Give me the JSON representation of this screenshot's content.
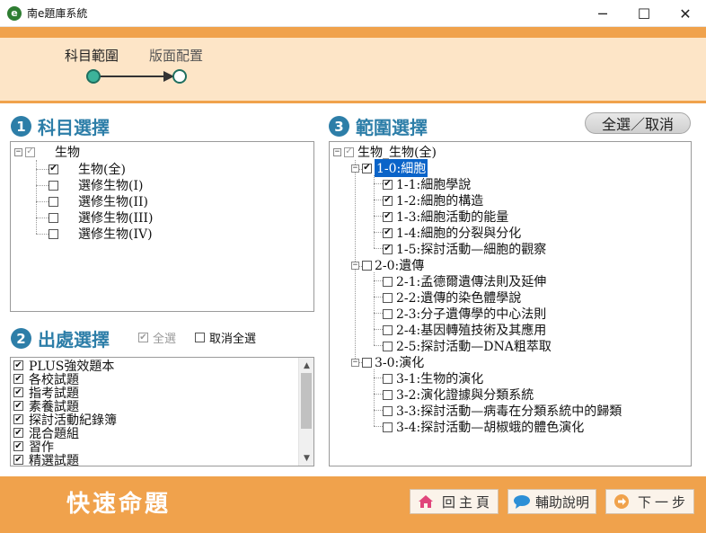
{
  "window": {
    "title": "南e題庫系統",
    "app_icon_glyph": "e",
    "controls": {
      "minimize": "─",
      "maximize": "☐",
      "close": "✕"
    }
  },
  "wizard": {
    "steps": [
      {
        "label": "科目範圍",
        "active": true
      },
      {
        "label": "版面配置",
        "active": false
      }
    ],
    "accent_color": "#3cb39a"
  },
  "subject_section": {
    "number": "1",
    "heading": "科目選擇",
    "tree": {
      "root": {
        "label": "生物",
        "checked": true,
        "expander": "−"
      },
      "children": [
        {
          "label": "生物(全)",
          "checked": true
        },
        {
          "label": "選修生物(I)",
          "checked": false
        },
        {
          "label": "選修生物(II)",
          "checked": false
        },
        {
          "label": "選修生物(III)",
          "checked": false
        },
        {
          "label": "選修生物(IV)",
          "checked": false
        }
      ]
    }
  },
  "source_section": {
    "number": "2",
    "heading": "出處選擇",
    "select_all_label": "全選",
    "select_all_checked": true,
    "deselect_all_label": "取消全選",
    "deselect_all_checked": false,
    "items": [
      {
        "label": "PLUS強效題本",
        "checked": true
      },
      {
        "label": "各校試題",
        "checked": true
      },
      {
        "label": "指考試題",
        "checked": true
      },
      {
        "label": "素養試題",
        "checked": true
      },
      {
        "label": "探討活動紀錄簿",
        "checked": true
      },
      {
        "label": "混合題組",
        "checked": true
      },
      {
        "label": "習作",
        "checked": true
      },
      {
        "label": "精選試題",
        "checked": true
      }
    ]
  },
  "range_section": {
    "number": "3",
    "heading": "範圍選擇",
    "select_all_button": "全選／取消",
    "tree": {
      "root": {
        "label": "生物_生物(全)",
        "checked": true
      },
      "chapters": [
        {
          "label": "1-0:細胞",
          "checked": true,
          "selected": true,
          "items": [
            {
              "label": "1-1:細胞學說",
              "checked": true
            },
            {
              "label": "1-2:細胞的構造",
              "checked": true
            },
            {
              "label": "1-3:細胞活動的能量",
              "checked": true
            },
            {
              "label": "1-4:細胞的分裂與分化",
              "checked": true
            },
            {
              "label": "1-5:探討活動—細胞的觀察",
              "checked": true
            }
          ]
        },
        {
          "label": "2-0:遺傳",
          "checked": false,
          "selected": false,
          "items": [
            {
              "label": "2-1:孟德爾遺傳法則及延伸",
              "checked": false
            },
            {
              "label": "2-2:遺傳的染色體學說",
              "checked": false
            },
            {
              "label": "2-3:分子遺傳學的中心法則",
              "checked": false
            },
            {
              "label": "2-4:基因轉殖技術及其應用",
              "checked": false
            },
            {
              "label": "2-5:探討活動—DNA粗萃取",
              "checked": false
            }
          ]
        },
        {
          "label": "3-0:演化",
          "checked": false,
          "selected": false,
          "items": [
            {
              "label": "3-1:生物的演化",
              "checked": false
            },
            {
              "label": "3-2:演化證據與分類系統",
              "checked": false
            },
            {
              "label": "3-3:探討活動—病毒在分類系統中的歸類",
              "checked": false
            },
            {
              "label": "3-4:探討活動—胡椒蛾的體色演化",
              "checked": false
            }
          ]
        }
      ]
    }
  },
  "footer": {
    "title": "快速命題",
    "home_button": "回主頁",
    "help_button": "輔助說明",
    "next_button": "下一步"
  },
  "colors": {
    "orange": "#f0a24c",
    "wizard_bg": "#fde5c7",
    "heading_blue": "#2d7ea8",
    "selection_blue": "#0a64c9"
  },
  "icons": {
    "app": "app-logo-icon",
    "home": "home-icon",
    "help": "chat-bubble-icon",
    "next": "arrow-right-circle-icon"
  }
}
